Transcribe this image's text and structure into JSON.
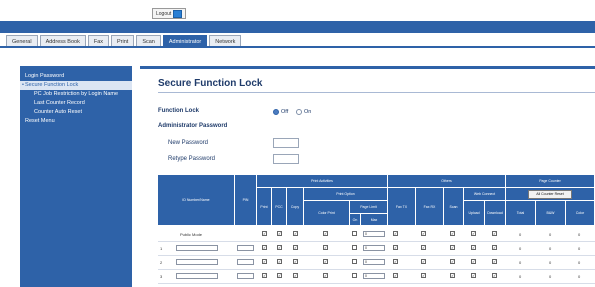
{
  "header": {
    "logout_label": "Logout"
  },
  "tabs": [
    {
      "label": "General"
    },
    {
      "label": "Address Book"
    },
    {
      "label": "Fax"
    },
    {
      "label": "Print"
    },
    {
      "label": "Scan"
    },
    {
      "label": "Administrator",
      "active": true
    },
    {
      "label": "Network"
    }
  ],
  "sidebar": {
    "items": [
      {
        "label": "Login Password"
      },
      {
        "label": "Secure Function Lock",
        "active": true
      },
      {
        "label": "PC Job Restriction by Login Name"
      },
      {
        "label": "Last Counter Record"
      },
      {
        "label": "Counter Auto Reset"
      },
      {
        "label": "Reset Menu"
      }
    ]
  },
  "page": {
    "title": "Secure Function Lock",
    "function_lock_label": "Function Lock",
    "off_label": "Off",
    "on_label": "On",
    "function_lock_value": "Off",
    "admin_password_label": "Administrator Password",
    "new_password_label": "New Password",
    "retype_password_label": "Retype Password"
  },
  "table": {
    "headers": {
      "id_name": "ID Number/Name",
      "pin": "PIN",
      "print_activities": "Print Activities",
      "print": "Print",
      "pcc": "PCC",
      "copy": "Copy",
      "print_option": "Print Option",
      "color_print": "Color Print",
      "page_limit": "Page Limit",
      "on": "On",
      "max": "Max",
      "others": "Others",
      "fax_tx": "Fax TX",
      "fax_rx": "Fax RX",
      "scan": "Scan",
      "web_connect": "Web Connect",
      "upload": "Upload",
      "download": "Download",
      "page_counter": "Page Counter",
      "all_counter_reset": "All Counter Reset",
      "total": "Total",
      "bw": "B&W",
      "color": "Color"
    },
    "rows": [
      {
        "num": "",
        "name": "Public Mode",
        "limit": "0",
        "total": "0",
        "bw": "0",
        "color": "0"
      },
      {
        "num": "1",
        "name": "",
        "limit": "0",
        "total": "0",
        "bw": "0",
        "color": "0"
      },
      {
        "num": "2",
        "name": "",
        "limit": "0",
        "total": "0",
        "bw": "0",
        "color": "0"
      },
      {
        "num": "3",
        "name": "",
        "limit": "0",
        "total": "0",
        "bw": "0",
        "color": "0"
      }
    ]
  },
  "colors": {
    "accent": "#2e62a8",
    "title": "#1f3b6a"
  }
}
